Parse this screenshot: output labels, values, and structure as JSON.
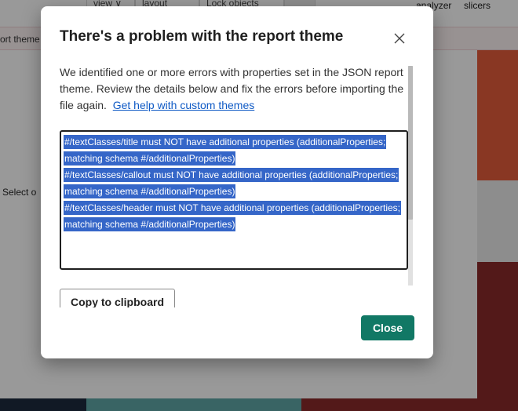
{
  "background": {
    "ribbon_tabs": [
      "view ∨",
      "layout",
      "Lock objects",
      ""
    ],
    "ribbon_labels": [
      "analyzer",
      "slicers"
    ],
    "infobar_text": "ort theme",
    "select_label": "Select o"
  },
  "dialog": {
    "title": "There's a problem with the report theme",
    "description": "We identified one or more errors with properties set in the JSON report theme. Review the details below and fix the errors before importing the file again.",
    "help_link": "Get help with custom themes",
    "errors": [
      "#/textClasses/title must NOT have additional properties (additionalProperties;",
      "matching schema #/additionalProperties)",
      "#/textClasses/callout must NOT have additional properties (additionalProperties;",
      "matching schema #/additionalProperties)",
      "#/textClasses/header must NOT have additional properties (additionalProperties;",
      "matching schema #/additionalProperties)"
    ],
    "copy_button": "Copy to clipboard",
    "close_button": "Close"
  },
  "colors": {
    "primary_button": "#117865",
    "selection": "#3566c8",
    "link": "#0f5ac5"
  },
  "icons": {
    "close": "close-icon"
  }
}
